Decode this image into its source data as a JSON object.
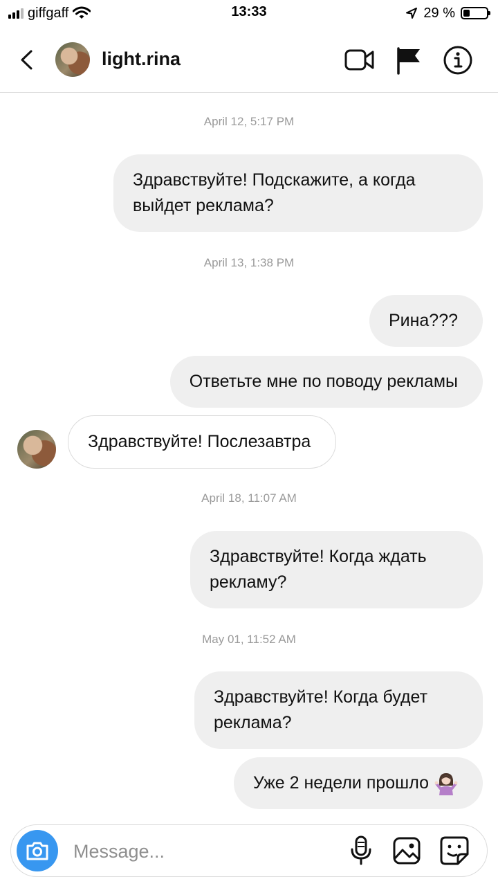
{
  "status_bar": {
    "carrier": "giffgaff",
    "time": "13:33",
    "battery_percent": "29 %",
    "battery_level": 0.29
  },
  "header": {
    "username": "light.rina",
    "icons": [
      "chevron-left-icon",
      "video-camera-icon",
      "flag-icon",
      "info-icon"
    ]
  },
  "thread": {
    "timestamps": [
      "April 12, 5:17 PM",
      "April 13, 1:38 PM",
      "April 18, 11:07 AM",
      "May 01, 11:52 AM"
    ],
    "messages": [
      {
        "direction": "outgoing",
        "text": "Здравствуйте! Подскажите, а когда выйдет реклама?"
      },
      {
        "direction": "outgoing",
        "text": "Рина???"
      },
      {
        "direction": "outgoing",
        "text": "Ответьте мне по поводу рекламы"
      },
      {
        "direction": "incoming",
        "text": "Здравствуйте! Послезавтра"
      },
      {
        "direction": "outgoing",
        "text": "Здравствуйте! Когда ждать рекламу?"
      },
      {
        "direction": "outgoing",
        "text": "Здравствуйте! Когда будет реклама?"
      },
      {
        "direction": "outgoing",
        "text": "Уже 2 недели прошло",
        "emoji": "woman-shrugging-emoji"
      }
    ]
  },
  "composer": {
    "placeholder": "Message...",
    "value": "",
    "icons": [
      "camera-icon",
      "microphone-icon",
      "gallery-icon",
      "sticker-icon"
    ]
  },
  "colors": {
    "bubble_outgoing": "#efefef",
    "bubble_incoming_border": "#dbdbdb",
    "timestamp": "#9a9a9a",
    "camera_button": "#3897f0",
    "placeholder": "#8e8e8e"
  }
}
